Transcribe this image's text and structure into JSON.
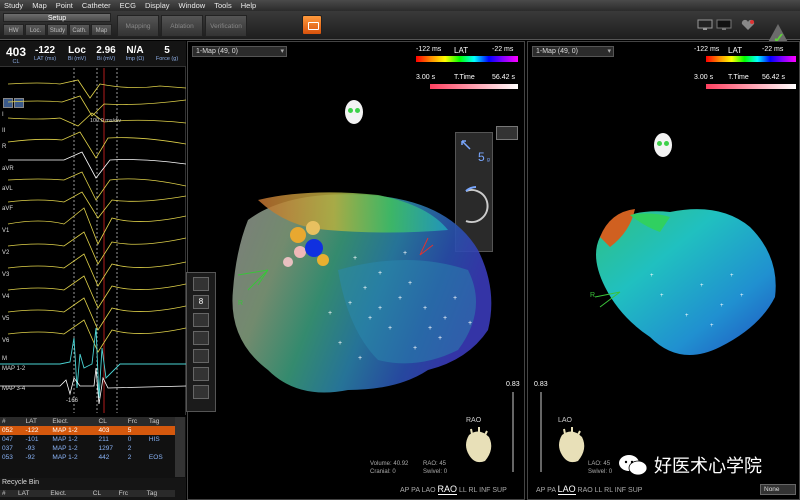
{
  "menu": [
    "Study",
    "Map",
    "Point",
    "Catheter",
    "ECG",
    "Display",
    "Window",
    "Tools",
    "Help"
  ],
  "toolbar": {
    "setup": "Setup",
    "subtabs": [
      "HW",
      "Loc.",
      "Study",
      "Cath.",
      "Map"
    ],
    "bigtabs": [
      "Mapping",
      "Ablation",
      "Verification"
    ]
  },
  "readouts": [
    {
      "value": "403",
      "unit": "CL"
    },
    {
      "value": "-122",
      "unit": "LAT (ms)"
    },
    {
      "value": "Loc",
      "unit": "Bi (mV)"
    },
    {
      "value": "2.96",
      "unit": "Bi (mV)"
    },
    {
      "value": "N/A",
      "unit": "Imp (Ω)"
    },
    {
      "value": "5",
      "unit": "Force (g)"
    }
  ],
  "ecg": {
    "leads": [
      "I",
      "II",
      "R",
      "aVR",
      "aVL",
      "aVF",
      "V1",
      "V2",
      "V3",
      "V4",
      "V5",
      "V6",
      "M",
      "MAP 1-2",
      "MAP 3-4"
    ],
    "timer": "100.0 ms/div",
    "marker": "-166"
  },
  "table": {
    "headers": [
      "#",
      "LAT",
      "Elect.",
      "CL",
      "Frc",
      "Tag"
    ],
    "rows": [
      [
        "052",
        "-122",
        "MAP 1-2",
        "403",
        "5",
        ""
      ],
      [
        "047",
        "-101",
        "MAP 1-2",
        "211",
        "0",
        "HIS"
      ],
      [
        "037",
        "-93",
        "MAP 1-2",
        "1297",
        "2",
        ""
      ],
      [
        "053",
        "-92",
        "MAP 1-2",
        "442",
        "2",
        "EOS"
      ]
    ],
    "recycle_title": "Recycle Bin",
    "recycle_headers": [
      "#",
      "LAT",
      "Elect.",
      "CL",
      "Frc",
      "Tag"
    ]
  },
  "map1": {
    "title": "1-Map (49, 0)",
    "lat_min": "-122 ms",
    "lat_label": "LAT",
    "lat_max": "-22 ms",
    "tt_min": "3.00 s",
    "tt_label": "T.Time",
    "tt_max": "56.42 s",
    "force_value": "5",
    "force_unit": "g",
    "slider_value": "0.83",
    "view_label": "RAO",
    "volume_label": "Volume:",
    "volume": "40.92",
    "cranial_label": "Cranial:",
    "cranial": "0",
    "rao_label": "RAO:",
    "rao": "45",
    "swivel_label": "Swivel:",
    "swivel": "0",
    "orient": [
      "AP",
      "PA",
      "LAO",
      "RAO",
      "LL",
      "RL",
      "INF",
      "SUP"
    ],
    "active_orient": "RAO"
  },
  "map2": {
    "title": "1-Map (49, 0)",
    "lat_min": "-122 ms",
    "lat_label": "LAT",
    "lat_max": "-22 ms",
    "tt_min": "3.00 s",
    "tt_label": "T.Time",
    "tt_max": "56.42 s",
    "slider_value": "0.83",
    "view_label": "LAO",
    "volume_label": "Volume:",
    "volume": "40.92",
    "cranial_label": "Cranial:",
    "cranial": "0",
    "lao_label": "LAO:",
    "lao": "45",
    "swivel_label": "Swivel:",
    "swivel": "0",
    "orient": [
      "AP",
      "PA",
      "LAO",
      "RAO",
      "LL",
      "RL",
      "INF",
      "SUP"
    ],
    "active_orient": "LAO",
    "display_select": "None"
  },
  "side_tools_value": "8",
  "watermark": "好医术心学院"
}
